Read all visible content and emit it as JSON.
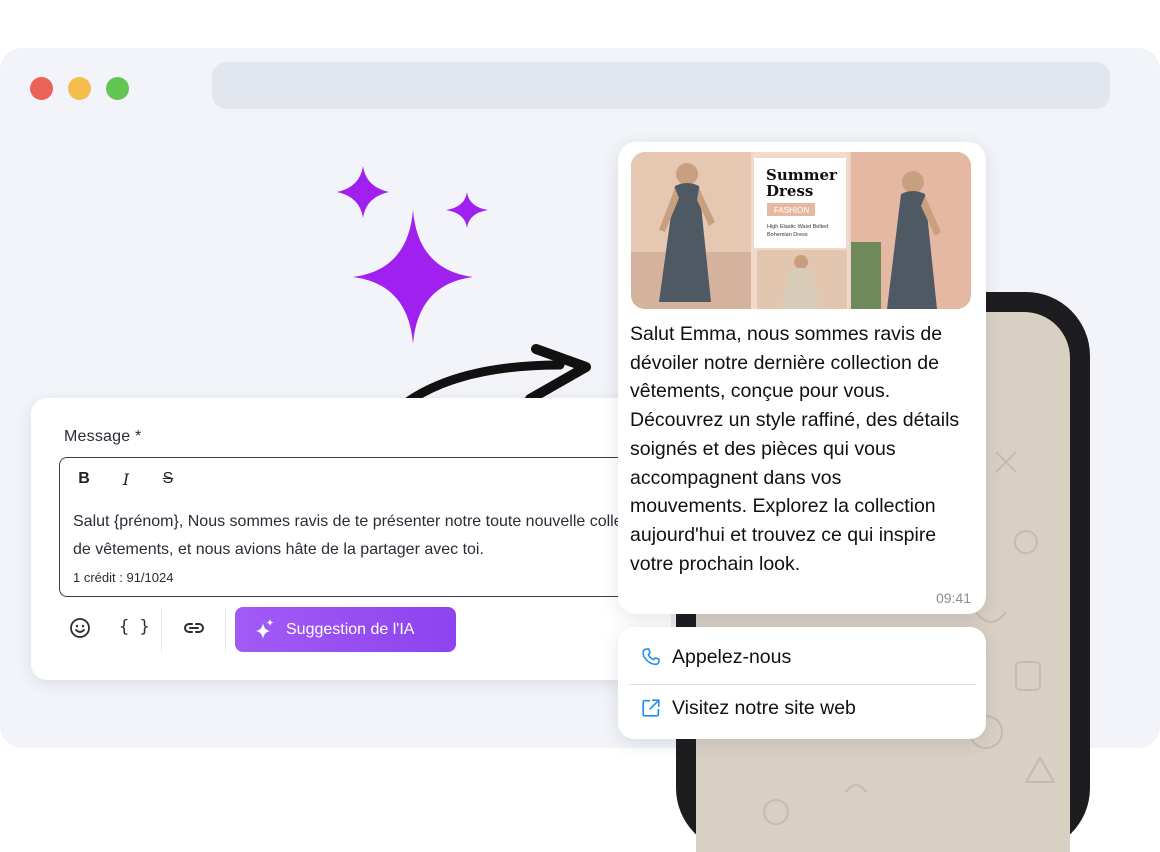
{
  "colors": {
    "accent_purple": "#9a4ef3",
    "sparkle": "#a020f0",
    "traffic_red": "#ec6158",
    "traffic_yellow": "#f4be4f",
    "traffic_green": "#62c554",
    "link_blue": "#1f8ef1"
  },
  "editor": {
    "label": "Message *",
    "format_bold": "B",
    "format_italic": "I",
    "format_strike": "S",
    "text_line1": "Salut {prénom}, Nous sommes ravis de te présenter notre toute nouvelle collection",
    "text_line2": "de vêtements, et nous avions hâte de la partager avec toi.",
    "credits": "1 crédit : 91/1024",
    "emoji_icon": "smiley-icon",
    "variables_label": "{ }",
    "link_icon": "link-icon",
    "ai_button_label": "Suggestion de l'IA"
  },
  "preview": {
    "image": {
      "title_line1": "Summer",
      "title_line2": "Dress",
      "tag": "FASHION",
      "caption_line1": "High Elastic Waist Belted",
      "caption_line2": "Bohemian Dress"
    },
    "lines": [
      "Salut Emma, nous sommes ravis de",
      "dévoiler notre dernière collection de",
      "vêtements, conçue pour vous.",
      "Découvrez un style raffiné, des détails",
      "soignés et des pièces qui vous",
      "accompagnent dans vos",
      "mouvements. Explorez la collection",
      "aujourd'hui et trouvez ce qui inspire",
      "votre prochain look."
    ],
    "time": "09:41",
    "actions": {
      "call": "Appelez-nous",
      "website": "Visitez notre site web"
    }
  }
}
